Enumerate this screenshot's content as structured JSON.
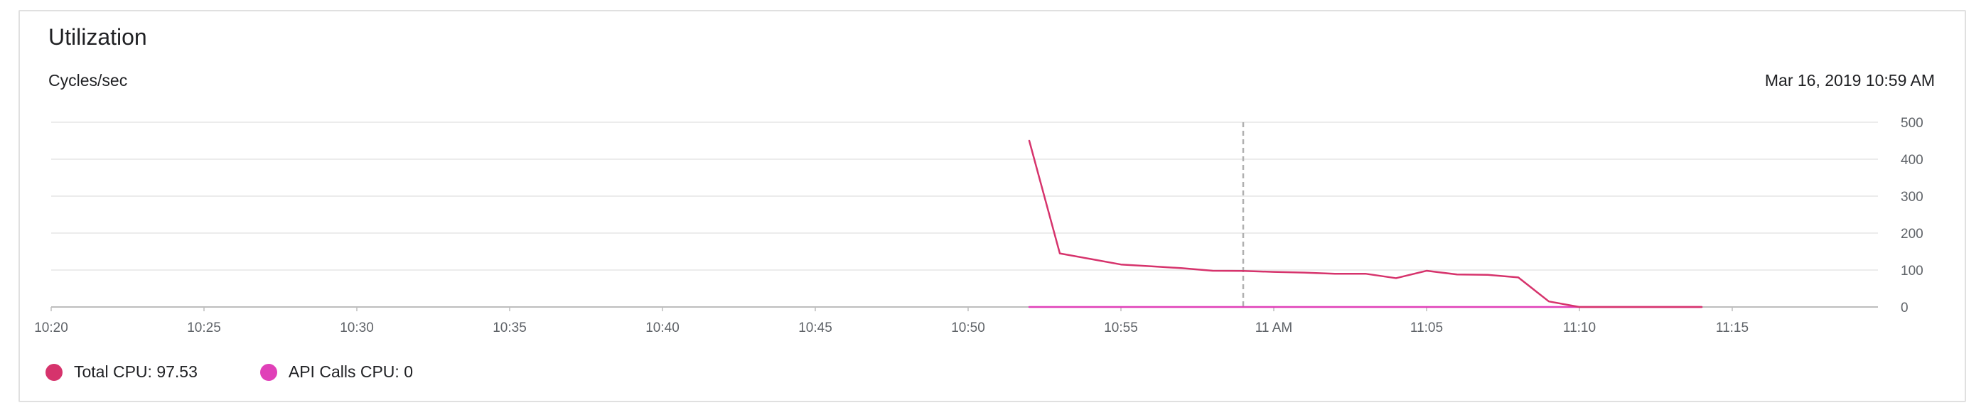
{
  "card": {
    "title": "Utilization",
    "subtitle": "Cycles/sec",
    "timestamp": "Mar 16, 2019 10:59 AM"
  },
  "colors": {
    "total_cpu": "#d6336c",
    "api_calls_cpu": "#e040b8",
    "grid": "#e6e6e6",
    "axis": "#bdbdbd",
    "cursor": "#b0b0b0"
  },
  "legend": [
    {
      "label": "Total CPU: 97.53",
      "color": "#d6336c"
    },
    {
      "label": "API Calls CPU: 0",
      "color": "#e040b8"
    }
  ],
  "chart_data": {
    "type": "line",
    "title": "Utilization",
    "ylabel": "Cycles/sec",
    "xlabel": "",
    "xlim": [
      "10:20",
      "11:18"
    ],
    "ylim": [
      0,
      500
    ],
    "x_ticks": [
      "10:20",
      "10:25",
      "10:30",
      "10:35",
      "10:40",
      "10:45",
      "10:50",
      "10:55",
      "11 AM",
      "11:05",
      "11:10",
      "11:15"
    ],
    "y_ticks": [
      "0",
      "100",
      "200",
      "300",
      "400",
      "500"
    ],
    "y_axis_position": "right",
    "grid": true,
    "legend_position": "bottom-left",
    "cursor_x": "10:59",
    "series": [
      {
        "name": "Total CPU",
        "color": "#d6336c",
        "points": [
          [
            "10:52",
            450
          ],
          [
            "10:53",
            145
          ],
          [
            "10:54",
            130
          ],
          [
            "10:55",
            115
          ],
          [
            "10:56",
            110
          ],
          [
            "10:57",
            105
          ],
          [
            "10:58",
            98
          ],
          [
            "10:59",
            97.53
          ],
          [
            "11:00",
            95
          ],
          [
            "11:01",
            93
          ],
          [
            "11:02",
            90
          ],
          [
            "11:03",
            90
          ],
          [
            "11:04",
            78
          ],
          [
            "11:05",
            98
          ],
          [
            "11:06",
            88
          ],
          [
            "11:07",
            87
          ],
          [
            "11:08",
            80
          ],
          [
            "11:09",
            15
          ],
          [
            "11:10",
            0
          ],
          [
            "11:11",
            0
          ],
          [
            "11:12",
            0
          ],
          [
            "11:13",
            0
          ],
          [
            "11:14",
            0
          ]
        ]
      },
      {
        "name": "API Calls CPU",
        "color": "#e040b8",
        "points": [
          [
            "10:52",
            0
          ],
          [
            "10:55",
            0
          ],
          [
            "11:00",
            0
          ],
          [
            "11:05",
            0
          ],
          [
            "11:10",
            0
          ],
          [
            "11:14",
            0
          ]
        ]
      }
    ]
  }
}
